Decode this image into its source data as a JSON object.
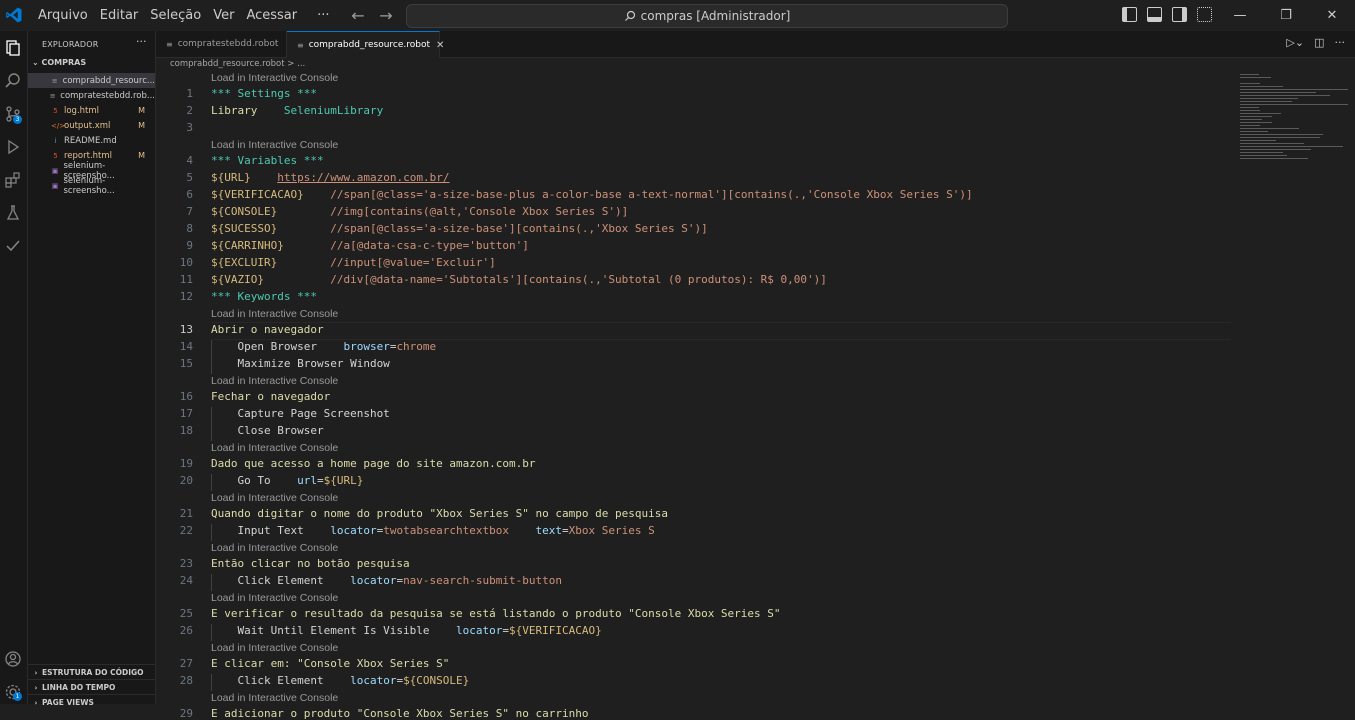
{
  "menu": [
    "Arquivo",
    "Editar",
    "Seleção",
    "Ver",
    "Acessar",
    "···"
  ],
  "search": {
    "text": "compras [Administrador]"
  },
  "sidebar": {
    "title": "EXPLORADOR",
    "folder": "COMPRAS",
    "files": [
      {
        "icon": "≡",
        "name": "comprabdd_resourc...",
        "mark": "",
        "color": "#cccccc",
        "selected": true
      },
      {
        "icon": "≡",
        "name": "compratestebdd.rob...",
        "mark": "",
        "color": "#cccccc",
        "selected": false
      },
      {
        "icon": "5",
        "name": "log.html",
        "mark": "M",
        "color": "#e2c08d",
        "selected": false
      },
      {
        "icon": "</>",
        "name": "output.xml",
        "mark": "M",
        "color": "#e2c08d",
        "selected": false
      },
      {
        "icon": "i",
        "name": "README.md",
        "mark": "",
        "color": "#cccccc",
        "selected": false
      },
      {
        "icon": "5",
        "name": "report.html",
        "mark": "M",
        "color": "#e2c08d",
        "selected": false
      },
      {
        "icon": "▣",
        "name": "selenium-screensho...",
        "mark": "",
        "color": "#cccccc",
        "selected": false
      },
      {
        "icon": "▣",
        "name": "selenium-screensho...",
        "mark": "",
        "color": "#cccccc",
        "selected": false
      }
    ],
    "sections": [
      "ESTRUTURA DO CÓDIGO",
      "LINHA DO TEMPO",
      "PAGE VIEWS"
    ]
  },
  "tabs": [
    {
      "label": "compratestebdd.robot",
      "active": false
    },
    {
      "label": "comprabdd_resource.robot",
      "active": true
    }
  ],
  "breadcrumb": "comprabdd_resource.robot > ...",
  "codelens": "Load in Interactive Console",
  "lines": [
    {
      "n": "1",
      "lens": true,
      "parts": [
        [
          "*** Settings ***",
          "sec"
        ]
      ]
    },
    {
      "n": "2",
      "parts": [
        [
          "Library    ",
          "kw"
        ],
        [
          "SeleniumLibrary",
          "sec"
        ]
      ]
    },
    {
      "n": "3",
      "parts": []
    },
    {
      "n": "4",
      "lens": true,
      "parts": [
        [
          "*** Variables ***",
          "sec"
        ]
      ]
    },
    {
      "n": "5",
      "parts": [
        [
          "${URL}",
          "var"
        ],
        [
          "    ",
          "plain"
        ],
        [
          "https://www.amazon.com.br/",
          "url"
        ]
      ]
    },
    {
      "n": "6",
      "parts": [
        [
          "${VERIFICACAO}",
          "var"
        ],
        [
          "    ",
          "plain"
        ],
        [
          "//span[@class='a-size-base-plus a-color-base a-text-normal'][contains(.,'Console Xbox Series S')]",
          "txt"
        ]
      ]
    },
    {
      "n": "7",
      "parts": [
        [
          "${CONSOLE}",
          "var"
        ],
        [
          "        ",
          "plain"
        ],
        [
          "//img[contains(@alt,'Console Xbox Series S')]",
          "txt"
        ]
      ]
    },
    {
      "n": "8",
      "parts": [
        [
          "${SUCESSO}",
          "var"
        ],
        [
          "        ",
          "plain"
        ],
        [
          "//span[@class='a-size-base'][contains(.,'Xbox Series S')]",
          "txt"
        ]
      ]
    },
    {
      "n": "9",
      "parts": [
        [
          "${CARRINHO}",
          "var"
        ],
        [
          "       ",
          "plain"
        ],
        [
          "//a[@data-csa-c-type='button']",
          "txt"
        ]
      ]
    },
    {
      "n": "10",
      "parts": [
        [
          "${EXCLUIR}",
          "var"
        ],
        [
          "        ",
          "plain"
        ],
        [
          "//input[@value='Excluir']",
          "txt"
        ]
      ]
    },
    {
      "n": "11",
      "parts": [
        [
          "${VAZIO}",
          "var"
        ],
        [
          "          ",
          "plain"
        ],
        [
          "//div[@data-name='Subtotals'][contains(.,'Subtotal (0 produtos): R$ 0,00')]",
          "txt"
        ]
      ]
    },
    {
      "n": "12",
      "parts": [
        [
          "*** Keywords ***",
          "sec"
        ]
      ]
    },
    {
      "n": "13",
      "lens": true,
      "current": true,
      "parts": [
        [
          "Abrir o navegador",
          "kw"
        ]
      ]
    },
    {
      "n": "14",
      "parts": [
        [
          "    Open Browser    ",
          "call"
        ],
        [
          "browser",
          "arg"
        ],
        [
          "=",
          "plain"
        ],
        [
          "chrome",
          "txt"
        ]
      ]
    },
    {
      "n": "15",
      "parts": [
        [
          "    Maximize Browser Window",
          "call"
        ]
      ]
    },
    {
      "n": "16",
      "lens": true,
      "parts": [
        [
          "Fechar o navegador",
          "kw"
        ]
      ]
    },
    {
      "n": "17",
      "parts": [
        [
          "    Capture Page Screenshot",
          "call"
        ]
      ]
    },
    {
      "n": "18",
      "parts": [
        [
          "    Close Browser",
          "call"
        ]
      ]
    },
    {
      "n": "19",
      "lens": true,
      "parts": [
        [
          "Dado que acesso a home page do site amazon.com.br",
          "kw"
        ]
      ]
    },
    {
      "n": "20",
      "parts": [
        [
          "    Go To    ",
          "call"
        ],
        [
          "url",
          "arg"
        ],
        [
          "=",
          "plain"
        ],
        [
          "${URL}",
          "var"
        ]
      ]
    },
    {
      "n": "21",
      "lens": true,
      "parts": [
        [
          "Quando digitar o nome do produto \"Xbox Series S\" no campo de pesquisa",
          "kw"
        ]
      ]
    },
    {
      "n": "22",
      "parts": [
        [
          "    Input Text    ",
          "call"
        ],
        [
          "locator",
          "arg"
        ],
        [
          "=",
          "plain"
        ],
        [
          "twotabsearchtextbox",
          "txt"
        ],
        [
          "    ",
          "plain"
        ],
        [
          "text",
          "arg"
        ],
        [
          "=",
          "plain"
        ],
        [
          "Xbox Series S",
          "txt"
        ]
      ]
    },
    {
      "n": "23",
      "lens": true,
      "parts": [
        [
          "Então clicar no botão pesquisa",
          "kw"
        ]
      ]
    },
    {
      "n": "24",
      "parts": [
        [
          "    Click Element    ",
          "call"
        ],
        [
          "locator",
          "arg"
        ],
        [
          "=",
          "plain"
        ],
        [
          "nav-search-submit-button",
          "txt"
        ]
      ]
    },
    {
      "n": "25",
      "lens": true,
      "parts": [
        [
          "E verificar o resultado da pesquisa se está listando o produto \"Console Xbox Series S\"",
          "kw"
        ]
      ]
    },
    {
      "n": "26",
      "parts": [
        [
          "    Wait Until Element Is Visible    ",
          "call"
        ],
        [
          "locator",
          "arg"
        ],
        [
          "=",
          "plain"
        ],
        [
          "${VERIFICACAO}",
          "var"
        ]
      ]
    },
    {
      "n": "27",
      "lens": true,
      "parts": [
        [
          "E clicar em: \"Console Xbox Series S\"",
          "kw"
        ]
      ]
    },
    {
      "n": "28",
      "parts": [
        [
          "    Click Element    ",
          "call"
        ],
        [
          "locator",
          "arg"
        ],
        [
          "=",
          "plain"
        ],
        [
          "${CONSOLE}",
          "var"
        ]
      ]
    },
    {
      "n": "29",
      "lens": true,
      "parts": [
        [
          "E adicionar o produto \"Console Xbox Series S\" no carrinho",
          "kw"
        ]
      ]
    }
  ],
  "badges": {
    "scm": "3",
    "account": "1"
  },
  "colors": {
    "accent": "#0078d4",
    "badge": "#0078d4",
    "modified": "#e2c08d"
  }
}
